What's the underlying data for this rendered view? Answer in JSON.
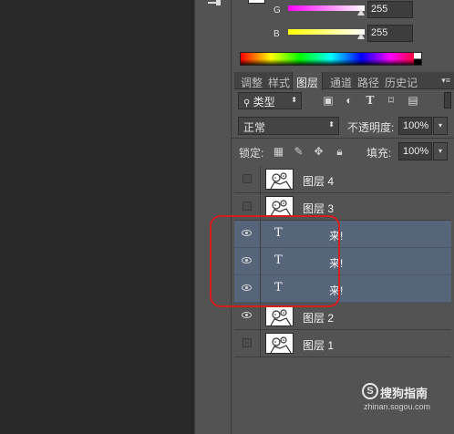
{
  "color_panel": {
    "g_label": "G",
    "g_value": "255",
    "b_label": "B",
    "b_value": "255"
  },
  "tabs": [
    {
      "label": "调整"
    },
    {
      "label": "样式"
    },
    {
      "label": "图层",
      "active": true
    },
    {
      "label": "通道"
    },
    {
      "label": "路径"
    },
    {
      "label": "历史记"
    }
  ],
  "filter": {
    "kind_label": "类型"
  },
  "blend": {
    "mode": "正常",
    "opacity_label": "不透明度:",
    "opacity_value": "100%"
  },
  "lock": {
    "label": "锁定:",
    "fill_label": "填充:",
    "fill_value": "100%"
  },
  "layers": [
    {
      "name": "图层 4",
      "type": "image",
      "visible": false,
      "selected": false
    },
    {
      "name": "图层 3",
      "type": "image",
      "visible": false,
      "selected": false
    },
    {
      "name": "来!",
      "type": "text",
      "visible": true,
      "selected": true
    },
    {
      "name": "来!",
      "type": "text",
      "visible": true,
      "selected": true
    },
    {
      "name": "来!",
      "type": "text",
      "visible": true,
      "selected": true
    },
    {
      "name": "图层 2",
      "type": "image",
      "visible": true,
      "selected": false
    },
    {
      "name": "图层 1",
      "type": "image",
      "visible": false,
      "selected": false
    }
  ],
  "watermark": {
    "logo": "S",
    "text": "搜狗指南",
    "url": "zhinan.sogou.com"
  },
  "colors": {
    "selection": "#56657a",
    "highlight": "#d41f1f",
    "panel_bg": "#535353"
  }
}
